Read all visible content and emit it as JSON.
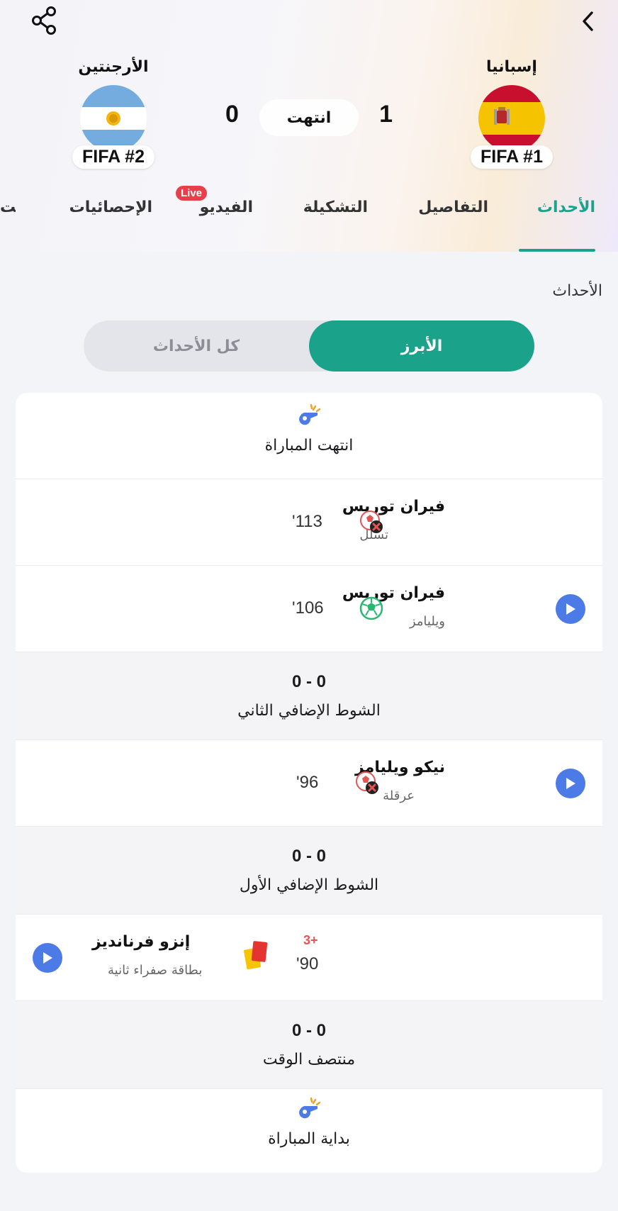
{
  "header": {
    "home_team": {
      "name": "إسبانيا",
      "rank": "FIFA #1",
      "score": "1"
    },
    "away_team": {
      "name": "الأرجنتين",
      "rank": "FIFA #2",
      "score": "0"
    },
    "status": "انتهت"
  },
  "tabs": [
    {
      "label": "الأحداث",
      "active": true
    },
    {
      "label": "التفاصيل"
    },
    {
      "label": "التشكيلة"
    },
    {
      "label": "الفيديو",
      "badge": "Live"
    },
    {
      "label": "الإحصائيات"
    },
    {
      "label": "الت"
    }
  ],
  "section_title": "الأحداث",
  "filter": {
    "active": "الأبرز",
    "inactive": "كل الأحداث"
  },
  "events": {
    "end": "انتهت المباراة",
    "e1": {
      "player": "فيران توريس",
      "detail": "تسلل",
      "minute": "113'"
    },
    "e2": {
      "player": "فيران توريس",
      "detail": "ويليامز",
      "minute": "106'"
    },
    "p1": {
      "score": "0 - 0",
      "label": "الشوط الإضافي الثاني"
    },
    "e3": {
      "player": "نيكو ويليامز",
      "detail": "عرقلة",
      "minute": "96'"
    },
    "p2": {
      "score": "0 - 0",
      "label": "الشوط الإضافي الأول"
    },
    "e4": {
      "player": "إنزو فرنانديز",
      "detail": "بطاقة صفراء ثانية",
      "minute": "90'",
      "added": "+3"
    },
    "p3": {
      "score": "0 - 0",
      "label": "منتصف الوقت"
    },
    "start": "بداية المباراة"
  },
  "colors": {
    "accent": "#1aa38a",
    "live": "#e8404a",
    "play": "#4c7be8",
    "added_time": "#e35454"
  }
}
